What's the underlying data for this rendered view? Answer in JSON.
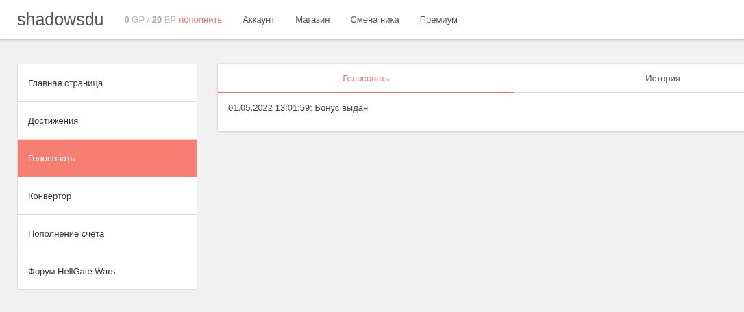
{
  "header": {
    "logo": "shadowsdu",
    "balance": "**0** GP / **20** BP",
    "topup_link": "пополнить",
    "nav": [
      "Аккаунт",
      "Магазин",
      "Смена ника",
      "Премиум"
    ]
  },
  "sidebar": {
    "items": [
      {
        "label": "Главная страница",
        "selected": false
      },
      {
        "label": "Достижения",
        "selected": false
      },
      {
        "label": "Голосовать",
        "selected": true
      },
      {
        "label": "Конвертор",
        "selected": false
      },
      {
        "label": "Пополнение счёта",
        "selected": false
      },
      {
        "label": "Форум HellGate Wars",
        "selected": false
      }
    ]
  },
  "panel": {
    "tabs": [
      {
        "label": "Голосовать",
        "selected": true
      },
      {
        "label": "История",
        "selected": false
      }
    ],
    "entries": [
      "01.05.2022 13:01:59: Бонус выдан"
    ]
  }
}
